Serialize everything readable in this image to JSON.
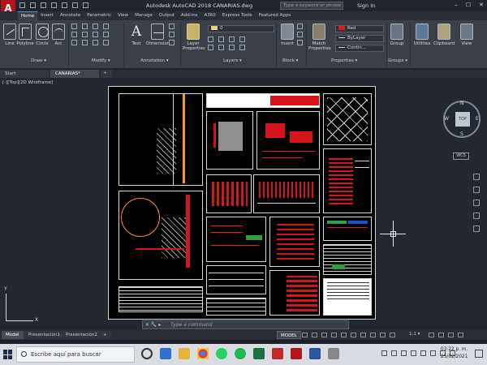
{
  "title_bar": {
    "app_title": "Autodesk AutoCAD 2018    CANARIAS.dwg",
    "search_placeholder": "Type a keyword or phrase",
    "sign_in": "Sign In",
    "logo_letter": "A"
  },
  "menu_tabs": [
    "Home",
    "Insert",
    "Annotate",
    "Parametric",
    "View",
    "Manage",
    "Output",
    "Add-ins",
    "A360",
    "Express Tools",
    "Featured Apps"
  ],
  "active_tab": "Home",
  "ribbon": {
    "draw_tools": [
      "Line",
      "Polyline",
      "Circle",
      "Arc"
    ],
    "annotation_tools": [
      "Text",
      "Dimension"
    ],
    "layer_tool": [
      "Layer",
      "Properties"
    ],
    "layer_combo": "0",
    "block_tool": "Insert",
    "match_tool": [
      "Match",
      "Properties"
    ],
    "color_combo": "Red",
    "linetype_combo": "ByLayer",
    "lineweight_combo": "Contin...",
    "group_tool": "Group",
    "utilities_tool": "Utilities",
    "clipboard_tool": "Clipboard",
    "view_tool": "View",
    "group_labels": {
      "draw": "Draw ▾",
      "modify": "Modify ▾",
      "annotation": "Annotation ▾",
      "layers": "Layers ▾",
      "block": "Block ▾",
      "properties": "Properties ▾",
      "groups": "Groups ▾"
    },
    "colors": {
      "red": "#e11b1b",
      "layer_icon": "#c7b26a"
    }
  },
  "doc_tabs": {
    "start": "Start",
    "file": "CANARIAS*",
    "add": "+"
  },
  "viewport_label": "[-][Top][2D Wireframe]",
  "viewcube": {
    "face": "TOP",
    "north": "N",
    "south": "S",
    "east": "E",
    "west": "W",
    "wcs": "WCS"
  },
  "ucs": {
    "x": "X",
    "y": "Y"
  },
  "command_line": {
    "prefix": "✕ 🔧 ▸",
    "placeholder": "Type a command"
  },
  "layout_tabs": [
    "Model",
    "Presentación1",
    "Presentación2",
    "+"
  ],
  "status": {
    "model": "MODEL",
    "scale": "1:1 ▾"
  },
  "taskbar": {
    "search": "Escribe aquí para buscar",
    "time": "03:22 p. m.",
    "date": "25/02/2021"
  }
}
